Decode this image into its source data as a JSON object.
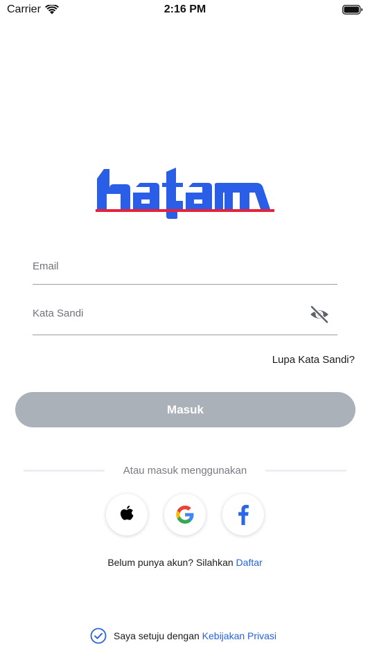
{
  "status_bar": {
    "carrier": "Carrier",
    "time": "2:16 PM"
  },
  "brand": {
    "logo_text": "hatam",
    "primary_color": "#2a5ee6",
    "accent_color": "#e8203a"
  },
  "form": {
    "email_placeholder": "Email",
    "password_placeholder": "Kata Sandi",
    "forgot_label": "Lupa Kata Sandi?",
    "login_label": "Masuk",
    "login_color": "#abb1b9"
  },
  "social": {
    "divider_text": "Atau masuk menggunakan",
    "providers": [
      "apple-icon",
      "google-icon",
      "facebook-icon"
    ]
  },
  "signup": {
    "prompt": "Belum punya akun? Silahkan",
    "link": "Daftar"
  },
  "privacy": {
    "text": "Saya setuju dengan",
    "link": "Kebijakan Privasi"
  },
  "link_color": "#2962d9"
}
